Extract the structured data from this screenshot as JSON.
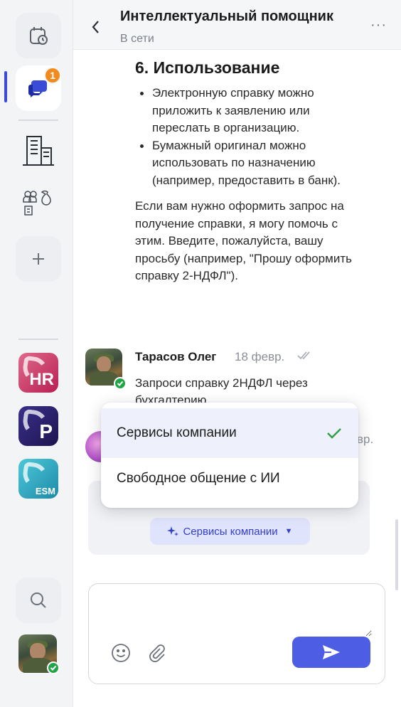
{
  "rail": {
    "notification_count": "1",
    "apps": [
      {
        "label": "HR"
      },
      {
        "label": "P"
      },
      {
        "label": "ESM"
      }
    ]
  },
  "header": {
    "title": "Интеллектуальный помощник",
    "status": "В сети",
    "more": "···"
  },
  "bot_message": {
    "heading": "6. Использование",
    "bullets": [
      "Электронную справку можно приложить к заявлению или переслать в организацию.",
      "Бумажный оригинал можно использовать по назначению (например, предоставить в банк)."
    ],
    "text": "Если вам нужно оформить запрос на получение справки, я могу помочь с этим. Введите, пожалуйста, вашу просьбу (например, \"Прошу оформить справку 2-НДФЛ\")."
  },
  "user_message": {
    "author": "Тарасов Олег",
    "date": "18 февр.",
    "text": "Запроси справку 2НДФЛ через бухгалтерию"
  },
  "bot_reply": {
    "date_tail": "вр."
  },
  "mode_selector": {
    "current": "Сервисы компании",
    "options": [
      {
        "label": "Сервисы компании",
        "selected": true
      },
      {
        "label": "Свободное общение с ИИ",
        "selected": false
      }
    ]
  },
  "composer": {
    "value": "",
    "placeholder": ""
  },
  "colors": {
    "accent": "#4d5ee4",
    "online": "#22a447",
    "badge": "#f28b1e",
    "check": "#2ea043"
  }
}
